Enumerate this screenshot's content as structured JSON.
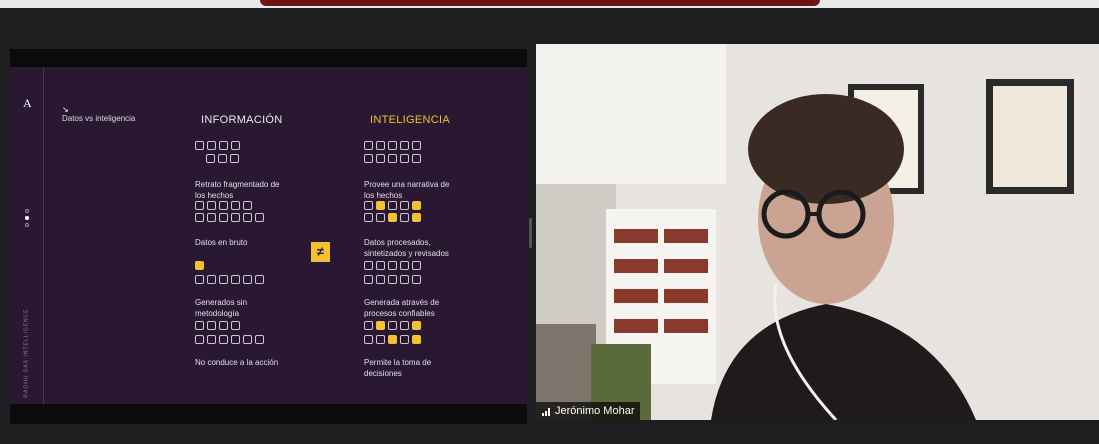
{
  "slide": {
    "logo": "A",
    "side_title": "Datos vs inteligencia",
    "vertical_label": "RAGHU DAS INTELLIGENCE",
    "cursor": "↘",
    "neq_symbol": "≠",
    "info": {
      "title": "INFORMACIÓN",
      "items": [
        "Retrato fragmentado de los hechos",
        "Datos en bruto",
        "Generados sin metodología",
        "No conduce a la acción"
      ]
    },
    "intel": {
      "title": "INTELIGENCIA",
      "items": [
        "Provee una narrativa de los hechos",
        "Datos procesados, sintetizados y revisados",
        "Generada através de procesos confiables",
        "Permite la toma de decisiones"
      ]
    }
  },
  "video": {
    "participant_name": "Jerónimo Mohar"
  },
  "colors": {
    "accent": "#f2c230",
    "slide_bg": "#2a1832"
  }
}
